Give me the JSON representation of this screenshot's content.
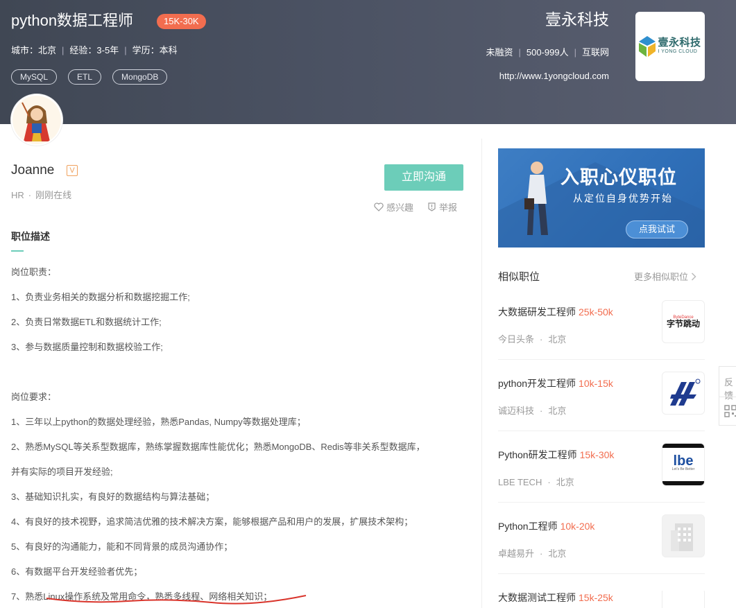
{
  "job": {
    "title": "python数据工程师",
    "salary": "15K-30K",
    "city": "城市：北京",
    "experience": "经验：3-5年",
    "education": "学历：本科",
    "tags": [
      "MySQL",
      "ETL",
      "MongoDB"
    ]
  },
  "company": {
    "name": "壹永科技",
    "funding": "未融资",
    "size": "500-999人",
    "industry": "互联网",
    "url": "http://www.1yongcloud.com",
    "logo_cn": "壹永科技",
    "logo_en": "I YONG CLOUD"
  },
  "recruiter": {
    "name": "Joanne",
    "badge": "V",
    "role": "HR",
    "status": "刚刚在线"
  },
  "actions": {
    "chat": "立即沟通",
    "interest": "感兴趣",
    "report": "举报"
  },
  "description": {
    "section_title": "职位描述",
    "lines": [
      "岗位职责：",
      "1、负责业务相关的数据分析和数据挖掘工作;",
      "2、负责日常数据ETL和数据统计工作;",
      "3、参与数据质量控制和数据校验工作;",
      "",
      "岗位要求：",
      "1、三年以上python的数据处理经验，熟悉Pandas, Numpy等数据处理库；",
      "2、熟悉MySQL等关系型数据库，熟练掌握数据库性能优化；熟悉MongoDB、Redis等非关系型数据库，",
      "并有实际的项目开发经验;",
      "3、基础知识扎实，有良好的数据结构与算法基础；",
      "4、有良好的技术视野，追求简洁优雅的技术解决方案，能够根据产品和用户的发展，扩展技术架构；",
      "5、有良好的沟通能力，能和不同背景的成员沟通协作；",
      "6、有数据平台开发经验者优先；",
      "7、熟悉Linux操作系统及常用命令，熟悉多线程、网络相关知识；"
    ]
  },
  "banner": {
    "title": "入职心仪职位",
    "subtitle": "从定位自身优势开始",
    "button": "点我试试"
  },
  "similar": {
    "title": "相似职位",
    "more": "更多相似职位",
    "items": [
      {
        "title": "大数据研发工程师",
        "salary": "25k-50k",
        "company": "今日头条",
        "city": "北京",
        "logo_text": "字节跳动",
        "logo_sub": "ByteDance"
      },
      {
        "title": "python开发工程师",
        "salary": "10k-15k",
        "company": "诚迈科技",
        "city": "北京",
        "logo_text": "",
        "logo_sub": ""
      },
      {
        "title": "Python研发工程师",
        "salary": "15k-30k",
        "company": "LBE TECH",
        "city": "北京",
        "logo_text": "lbe",
        "logo_sub": "Let's Be Better"
      },
      {
        "title": "Python工程师",
        "salary": "10k-20k",
        "company": "卓越易升",
        "city": "北京",
        "logo_text": "",
        "logo_sub": ""
      },
      {
        "title": "大数据测试工程师",
        "salary": "15k-25k",
        "company": "",
        "city": "",
        "logo_text": "",
        "logo_sub": ""
      }
    ]
  },
  "sidebar": {
    "feedback": "反馈"
  }
}
